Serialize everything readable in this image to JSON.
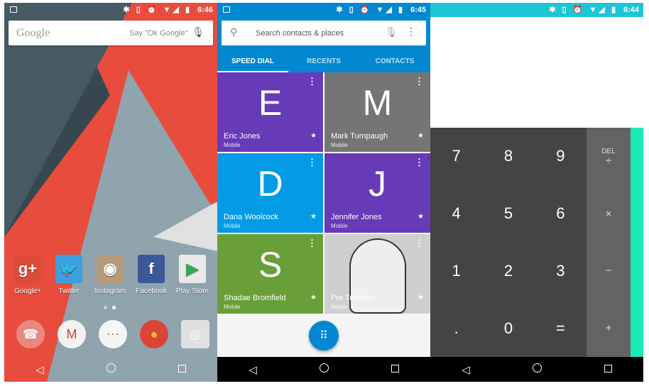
{
  "home": {
    "status": {
      "time": "6:46",
      "icons": "✱ ▯ ⏰ ▼◢ ▮"
    },
    "search": {
      "logo": "Google",
      "hint": "Say \"Ok Google\"",
      "mic_icon": "mic-icon"
    },
    "apps": [
      {
        "label": "Google+",
        "glyph": "g+",
        "color": "#dd4b39"
      },
      {
        "label": "Twitter",
        "glyph": "🐦",
        "color": "#3d9ee0"
      },
      {
        "label": "Instagram",
        "glyph": "◉",
        "color": "#b79a7a"
      },
      {
        "label": "Facebook",
        "glyph": "f",
        "color": "#3b5998"
      },
      {
        "label": "Play Store",
        "glyph": "▶",
        "color": "#e8e8e8"
      }
    ],
    "dock": [
      {
        "name": "hangouts-dialer",
        "glyph": "☎",
        "color": "#e8897f"
      },
      {
        "name": "gmail",
        "glyph": "M",
        "color": "#f2f2f2"
      },
      {
        "name": "app-drawer",
        "glyph": "⋯",
        "color": "#f5f5f5"
      },
      {
        "name": "chrome",
        "glyph": "●",
        "color": "#db4437"
      },
      {
        "name": "camera",
        "glyph": "◎",
        "color": "#e0e0e0"
      }
    ],
    "page_indicator": {
      "pages": 2,
      "current": 2
    }
  },
  "dialer": {
    "status": {
      "time": "6:45",
      "icons": "✱ ▯ ⏰ ▼◢ ▮"
    },
    "search": {
      "placeholder": "Search contacts & places"
    },
    "tabs": [
      {
        "label": "SPEED DIAL",
        "active": true
      },
      {
        "label": "RECENTS"
      },
      {
        "label": "CONTACTS"
      }
    ],
    "contacts": [
      {
        "letter": "E",
        "name": "Eric Jones",
        "type": "Mobile",
        "color": "#673ab7"
      },
      {
        "letter": "M",
        "name": "Mark Turnpaugh",
        "type": "Mobile",
        "color": "#757575"
      },
      {
        "letter": "D",
        "name": "Dana Woolcock",
        "type": "Mobile",
        "color": "#039be5"
      },
      {
        "letter": "J",
        "name": "Jennifer Jones",
        "type": "Mobile",
        "color": "#673ab7"
      },
      {
        "letter": "S",
        "name": "Shadae Bromfield",
        "type": "Mobile",
        "color": "#689f38"
      },
      {
        "letter": "",
        "name": "Pre Trollbey",
        "type": "Mobile",
        "color": "#cfcfcf",
        "photo": true
      }
    ]
  },
  "calculator": {
    "status": {
      "time": "6:44",
      "icons": "✱ ▯ ⏰ ▼◢ ▮"
    },
    "keys": [
      "7",
      "8",
      "9",
      "4",
      "5",
      "6",
      "1",
      "2",
      "3",
      ".",
      "0",
      "="
    ],
    "ops": [
      "DEL",
      "÷",
      "×",
      "−",
      "+"
    ],
    "colors": {
      "accent": "#1de9b6",
      "status": "#1cc6d6"
    }
  }
}
